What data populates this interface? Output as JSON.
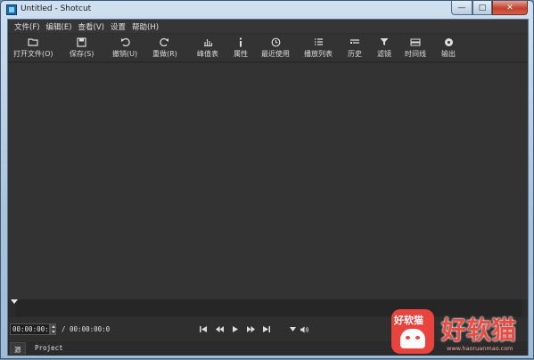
{
  "window": {
    "title": "Untitled - Shotcut",
    "minimize_label": "—",
    "maximize_label": "□",
    "close_label": "✕"
  },
  "menubar": {
    "items": [
      "文件(F)",
      "编辑(E)",
      "查看(V)",
      "设置",
      "帮助(H)"
    ]
  },
  "toolbar": {
    "items": [
      {
        "label": "打开文件(O)",
        "icon": "folder-open-icon"
      },
      {
        "label": "保存(S)",
        "icon": "save-icon"
      },
      {
        "label": "撤销(U)",
        "icon": "undo-icon"
      },
      {
        "label": "重做(R)",
        "icon": "redo-icon"
      },
      {
        "label": "峰值表",
        "icon": "peak-meter-icon"
      },
      {
        "label": "属性",
        "icon": "info-icon"
      },
      {
        "label": "最近使用",
        "icon": "clock-icon"
      },
      {
        "label": "播放列表",
        "icon": "list-icon"
      },
      {
        "label": "历史",
        "icon": "history-icon"
      },
      {
        "label": "滤镜",
        "icon": "filter-icon"
      },
      {
        "label": "时间线",
        "icon": "timeline-icon"
      },
      {
        "label": "输出",
        "icon": "export-icon"
      }
    ]
  },
  "transport": {
    "position": "00:00:00:0",
    "duration": "/ 00:00:00:0",
    "controls": [
      "skip-to-start-icon",
      "rewind-icon",
      "play-icon",
      "fast-forward-icon",
      "skip-to-end-icon",
      "volume-icon"
    ]
  },
  "tabs": {
    "items": [
      "源",
      "Project"
    ],
    "active": "源"
  },
  "watermark": {
    "badge_text": "好软猫",
    "brand_text": "好软猫",
    "url": "www.haoruanmao.com"
  },
  "colors": {
    "background": "#2f2f2f",
    "watermark_red": "#e8433c"
  }
}
